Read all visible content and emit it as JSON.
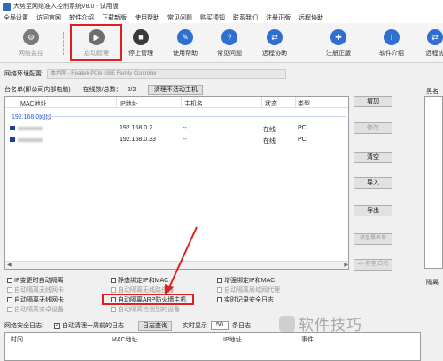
{
  "window": {
    "title": "大势至网络准入控制系统V8.0 - 试用版"
  },
  "menu": [
    "全局设置",
    "访问官网",
    "软件介绍",
    "下载新版",
    "使用帮助",
    "常见问题",
    "购买须知",
    "联系我们",
    "注册正版",
    "远程协助"
  ],
  "toolbar": {
    "buttons": [
      {
        "label": "网络监控",
        "icon": "gear-icon",
        "enabled": false,
        "color": "#7a7a7a"
      },
      {
        "label": "启动管理",
        "icon": "play-icon",
        "enabled": false,
        "color": "#6d6d6d"
      },
      {
        "label": "停止管理",
        "icon": "stop-icon",
        "enabled": true,
        "color": "#3a3a3a"
      },
      {
        "label": "使用帮助",
        "icon": "help-icon",
        "enabled": true,
        "color": "#2f6fd0"
      },
      {
        "label": "常见问题",
        "icon": "question-icon",
        "enabled": true,
        "color": "#2f6fd0"
      },
      {
        "label": "远程协助",
        "icon": "remote-icon",
        "enabled": true,
        "color": "#2f6fd0"
      },
      {
        "label": "注册正版",
        "icon": "register-icon",
        "enabled": true,
        "color": "#2f6fd0"
      },
      {
        "label": "软件介绍",
        "icon": "info-icon",
        "enabled": true,
        "color": "#2f6fd0"
      },
      {
        "label": "远程协",
        "icon": "remote-icon",
        "enabled": true,
        "color": "#2f6fd0"
      }
    ]
  },
  "network": {
    "label": "网络环境配置:",
    "value": "本地网 - Realtek PCIe GBE Family Controller"
  },
  "hosts": {
    "label": "台名单(即公司内部电脑)",
    "online_label": "在线数/总数：",
    "online_count": "2/2",
    "clear_button": "清理不活动主机"
  },
  "table": {
    "columns": [
      "MAC地址",
      "IP地址",
      "主机名",
      "状态",
      "类型"
    ],
    "group": "192.168.0网段",
    "rows": [
      {
        "mac": "",
        "ip": "192.168.0.2",
        "host": "--",
        "status": "在线",
        "type": "PC"
      },
      {
        "mac": "",
        "ip": "192.168.0.33",
        "host": "--",
        "status": "在线",
        "type": "PC"
      }
    ]
  },
  "side_buttons": [
    {
      "label": "增加",
      "enabled": true
    },
    {
      "label": "修改",
      "enabled": false
    },
    {
      "label": "清空",
      "enabled": true
    },
    {
      "label": "导入",
      "enabled": true
    },
    {
      "label": "导出",
      "enabled": true
    },
    {
      "label": "移至黑名单",
      "enabled": false
    },
    {
      "label": "<-- 移至 白名",
      "enabled": false
    }
  ],
  "right_panel": {
    "top_label": "黑名单",
    "bottom_label": "隔离"
  },
  "options": [
    {
      "label": "IP变更时自动隔离",
      "enabled": true,
      "checked": false
    },
    {
      "label": "自动隔离无线网卡",
      "enabled": false,
      "checked": false
    },
    {
      "label": "自动隔离无线网卡",
      "enabled": true,
      "checked": false
    },
    {
      "label": "自动隔离安卓设备",
      "enabled": false,
      "checked": false
    },
    {
      "label": "静态绑定IP和MAC",
      "enabled": true,
      "checked": false
    },
    {
      "label": "自动隔离无线路由器",
      "enabled": false,
      "checked": false
    },
    {
      "label": "自动隔离ARP防火墙主机",
      "enabled": true,
      "checked": false
    },
    {
      "label": "自动隔离检测到的设备",
      "enabled": false,
      "checked": false
    },
    {
      "label": "增强绑定IP和MAC",
      "enabled": true,
      "checked": false
    },
    {
      "label": "自动隔离局域网代理",
      "enabled": false,
      "checked": false
    },
    {
      "label": "实时记录安全日志",
      "enabled": true,
      "checked": false
    }
  ],
  "log": {
    "label": "网络安全日志:",
    "auto_clean": "自动清理一周前的日志",
    "query_button": "日志查询",
    "realtime_label": "实时显示",
    "count": "50",
    "unit": "条日志",
    "columns": [
      "时间",
      "MAC地址",
      "IP地址",
      "事件"
    ]
  },
  "watermark": "软件技巧",
  "colors": {
    "highlight": "#e02020",
    "link_blue": "#2a5bd7",
    "device_blue": "#1d3f9a"
  }
}
